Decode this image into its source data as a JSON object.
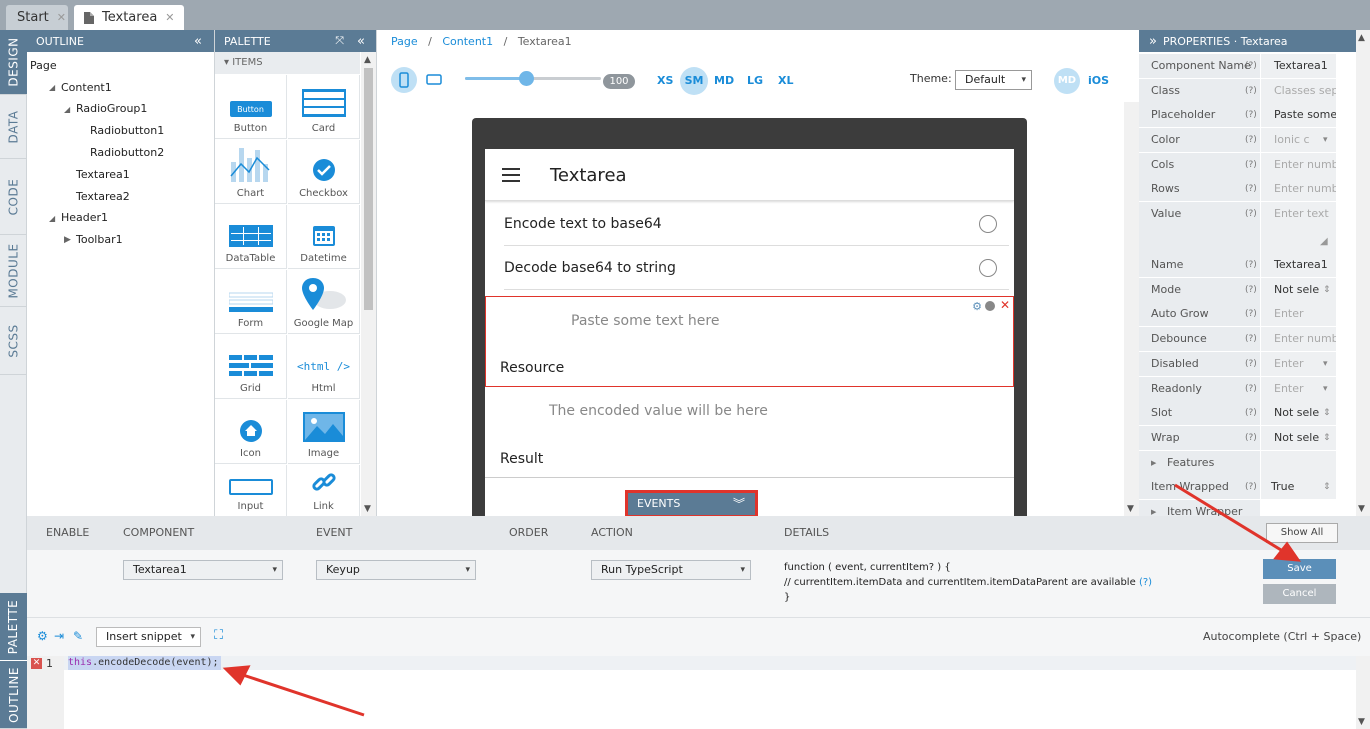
{
  "tabs": [
    {
      "label": "Start"
    },
    {
      "label": "Textarea"
    }
  ],
  "vertical_tabs": [
    "DESIGN",
    "DATA",
    "CODE",
    "MODULE",
    "SCSS"
  ],
  "bottom_vertical_tabs": [
    "PALETTE",
    "OUTLINE"
  ],
  "outline": {
    "title": "OUTLINE",
    "items": [
      "Page",
      "Content1",
      "RadioGroup1",
      "Radiobutton1",
      "Radiobutton2",
      "Textarea1",
      "Textarea2",
      "Header1",
      "Toolbar1"
    ]
  },
  "palette": {
    "title": "PALETTE",
    "section": "ITEMS",
    "items": [
      "Button",
      "Card",
      "Chart",
      "Checkbox",
      "DataTable",
      "Datetime",
      "Form",
      "Google Map",
      "Grid",
      "Html",
      "Icon",
      "Image",
      "Input",
      "Link"
    ],
    "button_preview": "Button"
  },
  "breadcrumb": [
    "Page",
    "Content1",
    "Textarea1"
  ],
  "toolbar": {
    "zoom": "100",
    "zoom_level": 0.45,
    "sizes": [
      "XS",
      "SM",
      "MD",
      "LG",
      "XL"
    ],
    "active_size": "SM",
    "theme_label": "Theme:",
    "theme_value": "Default",
    "mode_md": "MD",
    "mode_ios": "iOS"
  },
  "device": {
    "header_title": "Textarea",
    "radio1": "Encode text to base64",
    "radio2": "Decode base64 to string",
    "textarea1_placeholder": "Paste some text here",
    "textarea1_label": "Resource",
    "textarea2_placeholder": "The encoded value will be here",
    "textarea2_label": "Result",
    "events_label": "EVENTS"
  },
  "properties": {
    "title": "PROPERTIES · Textarea",
    "q": "(?)",
    "rows": [
      {
        "name": "Component Name",
        "value": "Textarea1",
        "placeholder": false
      },
      {
        "name": "Class",
        "value": "Classes sep",
        "placeholder": true
      },
      {
        "name": "Placeholder",
        "value": "Paste some",
        "placeholder": false
      },
      {
        "name": "Color",
        "value": "Ionic c",
        "placeholder": true
      },
      {
        "name": "Cols",
        "value": "Enter numb",
        "placeholder": true
      },
      {
        "name": "Rows",
        "value": "Enter numb",
        "placeholder": true
      },
      {
        "name": "Value",
        "value": "Enter text",
        "placeholder": true
      },
      {
        "name": "Name",
        "value": "Textarea1",
        "placeholder": false
      },
      {
        "name": "Mode",
        "value": "Not sele",
        "placeholder": false
      },
      {
        "name": "Auto Grow",
        "value": "Enter",
        "placeholder": true
      },
      {
        "name": "Debounce",
        "value": "Enter numb",
        "placeholder": true
      },
      {
        "name": "Disabled",
        "value": "Enter",
        "placeholder": true
      },
      {
        "name": "Readonly",
        "value": "Enter",
        "placeholder": true
      },
      {
        "name": "Slot",
        "value": "Not sele",
        "placeholder": false
      },
      {
        "name": "Wrap",
        "value": "Not sele",
        "placeholder": false
      },
      {
        "name": "Features",
        "value": "",
        "placeholder": false
      },
      {
        "name": "Item Wrapped",
        "value": "True",
        "placeholder": false
      },
      {
        "name": "Item Wrapper",
        "value": "",
        "placeholder": false
      }
    ]
  },
  "events": {
    "headers": [
      "ENABLE",
      "COMPONENT",
      "EVENT",
      "ORDER",
      "ACTION",
      "DETAILS"
    ],
    "show_all": "Show All",
    "component": "Textarea1",
    "event": "Keyup",
    "action": "Run TypeScript",
    "details_line1": "function ( event, currentItem? ) {",
    "details_line2": "// currentItem.itemData and currentItem.itemDataParent are available",
    "details_help": "(?)",
    "details_line3": "}",
    "save": "Save",
    "cancel": "Cancel"
  },
  "code": {
    "snippet": "Insert snippet",
    "autocomplete": "Autocomplete (Ctrl + Space)",
    "line_number": "1",
    "code_keyword": "this",
    "code_rest": ".encodeDecode(event);"
  },
  "colors": {
    "accent": "#5b7b95",
    "link": "#1a8cd8",
    "save": "#5b8fb9",
    "highlight": "#e0342b"
  }
}
